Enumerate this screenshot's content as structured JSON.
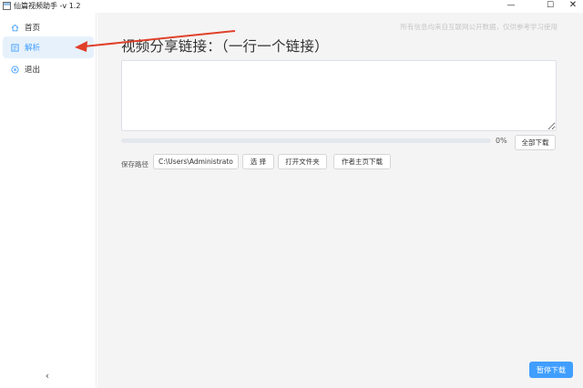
{
  "window": {
    "title": "仙篇视频助手 -v 1.2",
    "controls": {
      "minimize": "—",
      "maximize": "☐",
      "close": "✕"
    }
  },
  "sidebar": {
    "items": [
      {
        "label": "首页",
        "icon": "home-icon",
        "active": false
      },
      {
        "label": "解析",
        "icon": "parse-icon",
        "active": true
      },
      {
        "label": "退出",
        "icon": "exit-icon",
        "active": false
      }
    ],
    "collapse_glyph": "‹"
  },
  "main": {
    "watermark": "所有信息均来自互联网公开数据，仅供参考学习使用",
    "heading": "视频分享链接：（一行一个链接）",
    "textarea_value": "",
    "progress_percent": 0,
    "progress_text": "0%",
    "download_all_label": "全部下载",
    "save_path_label": "保存路径",
    "save_path_value": "C:\\Users\\Administrator\\I",
    "choose_label": "选 择",
    "open_folder_label": "打开文件夹",
    "author_download_label": "作者主页下载",
    "pause_label": "暂停下载"
  },
  "colors": {
    "accent": "#409eff",
    "active_bg": "#e6f1fc",
    "annotation_arrow": "#e0402a"
  }
}
